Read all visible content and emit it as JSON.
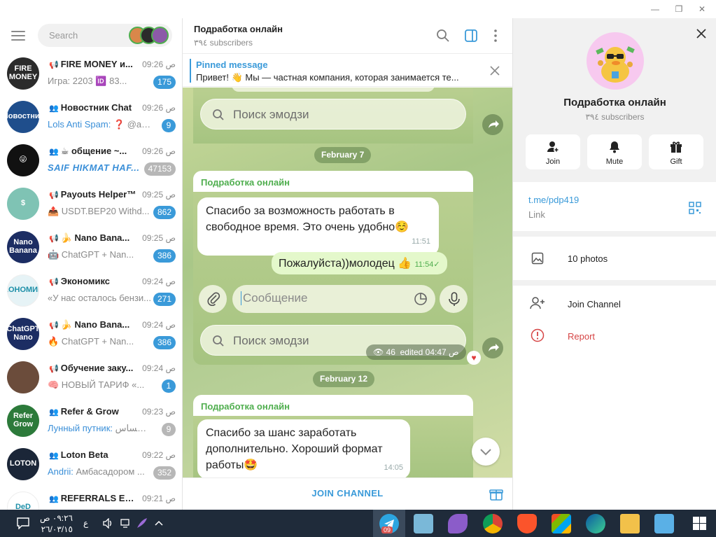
{
  "window": {
    "minimize": "—",
    "restore": "❐",
    "close": "✕"
  },
  "sidebar": {
    "search_placeholder": "Search",
    "chats": [
      {
        "name": "FIRE MONEY и...",
        "type": "channel",
        "time": "09:26 ص",
        "sender": "",
        "preview": "Игра: 2203 🆔 83...",
        "badge": "175",
        "muted": false,
        "avatar_text": "FIRE MONEY",
        "avatar_color": "#2b2b2b"
      },
      {
        "name": "Новостник Chat",
        "type": "group",
        "time": "09:26 ص",
        "sender": "Lols Anti Spam:",
        "preview": " ❓ @ale...",
        "badge": "9",
        "muted": false,
        "avatar_text": "Новостник",
        "avatar_color": "#1f4e8c"
      },
      {
        "name": "☕ общение ~...",
        "type": "group",
        "time": "09:26 ص",
        "sender": "",
        "preview": "SAIF HIKMAT HAF...",
        "badge": "47153",
        "muted": true,
        "italic": true,
        "avatar_text": "😜",
        "avatar_color": "#111111"
      },
      {
        "name": "Payouts Helper™",
        "type": "channel",
        "time": "09:25 ص",
        "sender": "",
        "preview": "📤 USDT.BEP20 Withd...",
        "badge": "862",
        "muted": false,
        "avatar_text": "$",
        "avatar_color": "#7fc3b4"
      },
      {
        "name": "🍌 Nano Bana...",
        "type": "channel",
        "time": "09:25 ص",
        "sender": "",
        "preview": "🤖 ChatGPT + Nan...",
        "badge": "386",
        "muted": false,
        "avatar_text": "Nano Banana",
        "avatar_color": "#1c2d63"
      },
      {
        "name": "Экономикс",
        "type": "channel",
        "time": "09:24 ص",
        "sender": "",
        "preview": "«У нас осталось бензи...",
        "badge": "271",
        "muted": false,
        "avatar_text": "ЭКОНОМИКС",
        "avatar_color": "#e6f3f6"
      },
      {
        "name": "🍌 Nano Bana...",
        "type": "channel",
        "time": "09:24 ص",
        "sender": "",
        "preview": "🔥 ChatGPT + Nan...",
        "badge": "386",
        "muted": false,
        "avatar_text": "ChatGPT Nano",
        "avatar_color": "#1c2d63"
      },
      {
        "name": "Обучение заку...",
        "type": "channel",
        "time": "09:24 ص",
        "sender": "",
        "preview": "🧠 НОВЫЙ ТАРИФ «...",
        "badge": "1",
        "muted": false,
        "avatar_text": "",
        "avatar_color": "#6b4c3b"
      },
      {
        "name": "Refer & Grow",
        "type": "group",
        "time": "09:23 ص",
        "sender": "Лунный путник:",
        "preview": " عساس ...",
        "badge": "9",
        "muted": true,
        "avatar_text": "Refer Grow",
        "avatar_color": "#2c7a3a"
      },
      {
        "name": "Loton Beta",
        "type": "group",
        "time": "09:22 ص",
        "sender": "Andrii:",
        "preview": " Амбасадором ...",
        "badge": "352",
        "muted": true,
        "avatar_text": "LOTON",
        "avatar_color": "#1b2638"
      },
      {
        "name": "REFERRALS EXC...",
        "type": "group",
        "time": "09:21 ص",
        "sender": "",
        "preview": "",
        "badge": "",
        "muted": false,
        "avatar_text": "DeD",
        "avatar_color": "#ffffff"
      }
    ]
  },
  "channel": {
    "title": "Подработка онлайн",
    "subscribers": "٣٩٤ subscribers",
    "pinned_title": "Pinned message",
    "pinned_text": "Привет! 👋 Мы — частная компания, которая занимается те...",
    "join_label": "JOIN CHANNEL"
  },
  "messages": {
    "search_emoji": "Поиск эмодзи",
    "date1": "February 7",
    "author": "Подработка онлайн",
    "msg1": "Спасибо за возможность работать в свободное время. Это очень удобно☺️",
    "msg1_time": "11:51",
    "msg2": "Пожалуйста))молодец 👍",
    "msg2_time": "11:54",
    "composer_placeholder": "Сообщение",
    "views": "46",
    "edited": "edited 04:47 ص",
    "date2": "February 12",
    "msg3": "Спасибо за шанс заработать дополнительно. Хороший формат работы🤩",
    "msg3_time": "14:05"
  },
  "info": {
    "title": "Подработка онлайн",
    "subscribers": "٣٩٤ subscribers",
    "buttons": [
      {
        "label": "Join"
      },
      {
        "label": "Mute"
      },
      {
        "label": "Gift"
      }
    ],
    "link": "t.me/pdp419",
    "link_label": "Link",
    "photos": "10 photos",
    "join_channel": "Join Channel",
    "report": "Report"
  },
  "taskbar": {
    "time": "٠٩:٢٦ ص",
    "date": "٢٦/٠٣/١٥",
    "lang": "ع",
    "telegram_badge": "09"
  },
  "colors": {
    "accent": "#3a9ad9",
    "author_green": "#4fae4e",
    "report_red": "#d64545",
    "taskbar": "#1f2b3a"
  }
}
